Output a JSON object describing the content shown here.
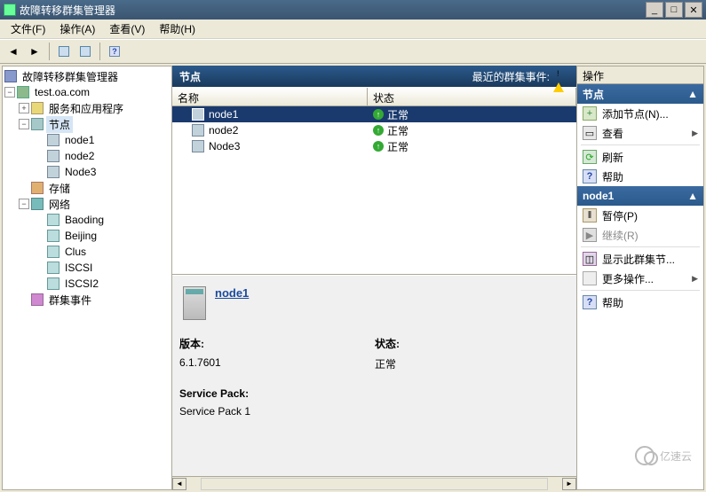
{
  "window": {
    "title": "故障转移群集管理器"
  },
  "menu": {
    "file": "文件(F)",
    "action": "操作(A)",
    "view": "查看(V)",
    "help": "帮助(H)"
  },
  "tree": {
    "root": "故障转移群集管理器",
    "cluster": "test.oa.com",
    "services": "服务和应用程序",
    "nodes": "节点",
    "node_items": [
      "node1",
      "node2",
      "Node3"
    ],
    "storage": "存储",
    "networks": "网络",
    "net_items": [
      "Baoding",
      "Beijing",
      "Clus",
      "ISCSI",
      "ISCSI2"
    ],
    "events": "群集事件"
  },
  "list": {
    "header_title": "节点",
    "recent_events": "最近的群集事件:",
    "col_name": "名称",
    "col_status": "状态",
    "rows": [
      {
        "name": "node1",
        "status": "正常"
      },
      {
        "name": "node2",
        "status": "正常"
      },
      {
        "name": "Node3",
        "status": "正常"
      }
    ]
  },
  "detail": {
    "node_name": "node1",
    "version_label": "版本:",
    "version_value": "6.1.7601",
    "status_label": "状态:",
    "status_value": "正常",
    "sp_label": "Service Pack:",
    "sp_value": "Service Pack 1"
  },
  "actions": {
    "panel_title": "操作",
    "group1_title": "节点",
    "add_node": "添加节点(N)...",
    "view": "查看",
    "refresh": "刷新",
    "help": "帮助",
    "group2_title": "node1",
    "pause": "暂停(P)",
    "resume": "继续(R)",
    "show_cluster": "显示此群集节...",
    "more": "更多操作...",
    "help2": "帮助"
  },
  "watermark": "亿速云"
}
